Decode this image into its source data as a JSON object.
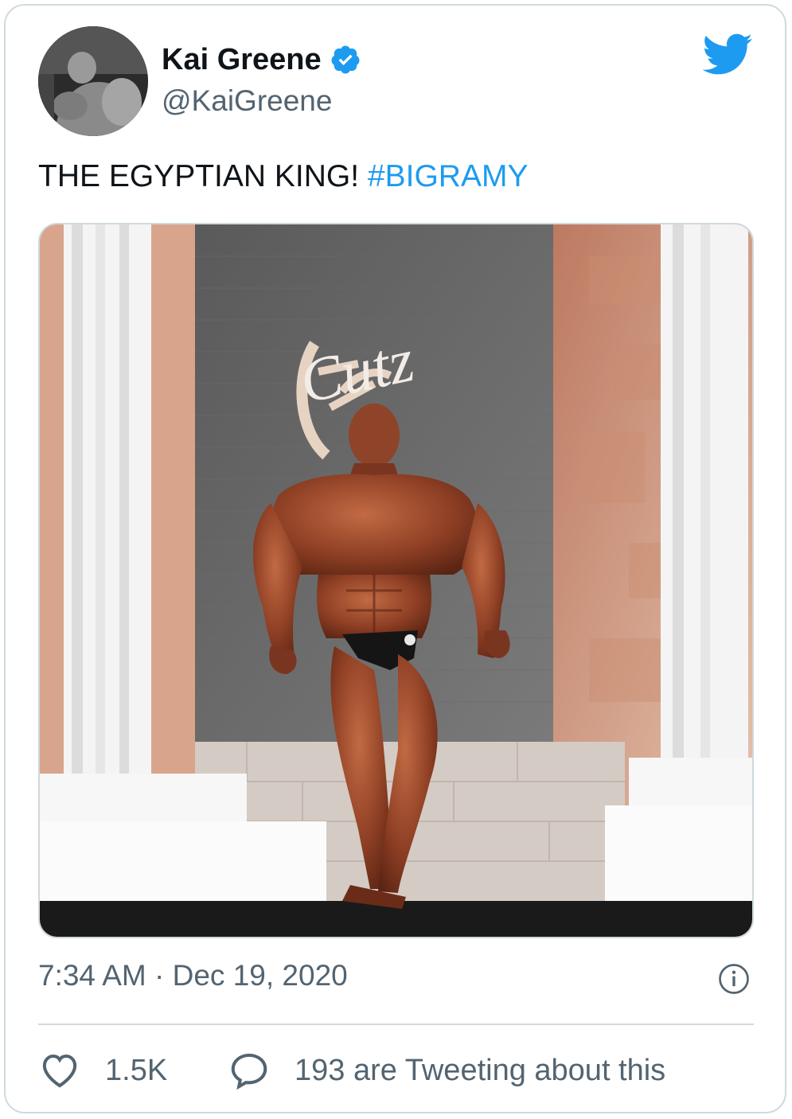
{
  "author": {
    "name": "Kai Greene",
    "handle": "@KaiGreene",
    "verified": true
  },
  "tweet": {
    "text": "THE EGYPTIAN KING! ",
    "hashtag": "#BIGRAMY"
  },
  "meta": {
    "timestamp": "7:34 AM · Dec 19, 2020"
  },
  "actions": {
    "likes": "1.5K",
    "conversation": "193 are Tweeting about this"
  },
  "icons": {
    "brand": "twitter-bird-icon",
    "verified": "verified-badge-icon",
    "info": "info-icon",
    "like": "heart-icon",
    "reply": "speech-bubble-icon"
  },
  "colors": {
    "brand": "#1d9bf0",
    "text": "#0f1419",
    "muted": "#536471",
    "border": "#cfd9de"
  }
}
